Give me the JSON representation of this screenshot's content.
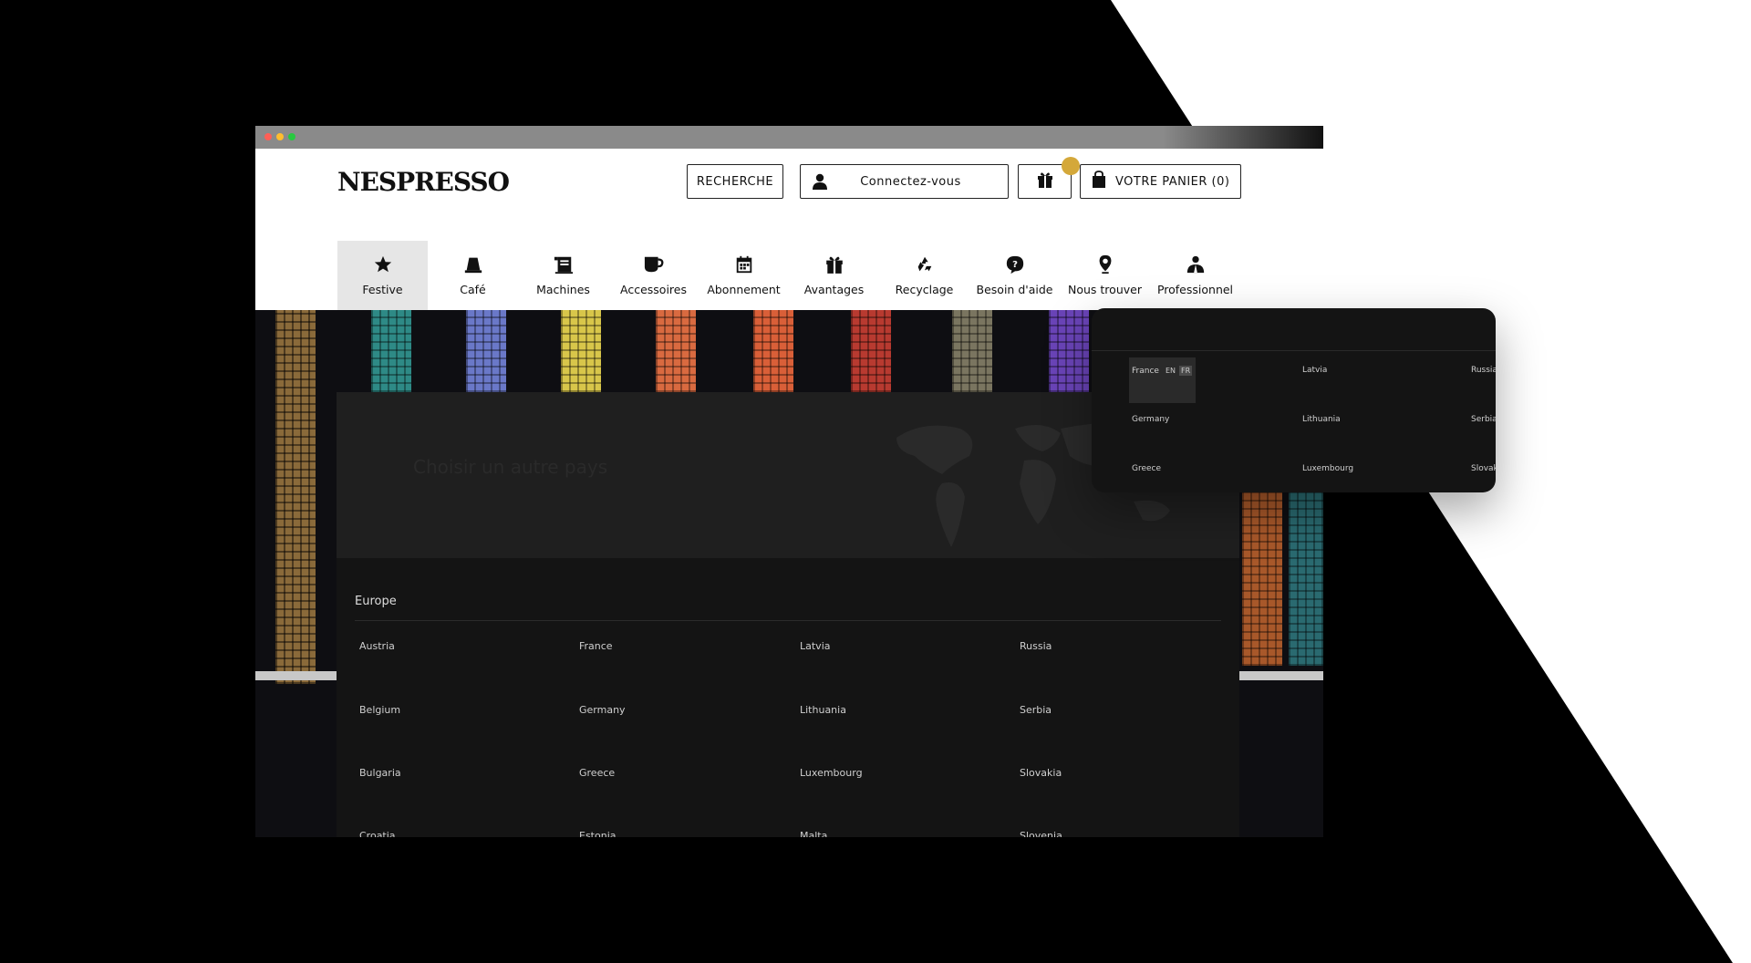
{
  "brand": {
    "logo_text": "NESPRESSO"
  },
  "header": {
    "search_label": "RECHERCHE",
    "login_label": "Connectez-vous",
    "cart_label": "VOTRE PANIER (0)",
    "accent_color": "#d4a83a"
  },
  "nav": {
    "items": [
      {
        "label": "Festive",
        "icon": "star-icon"
      },
      {
        "label": "Café",
        "icon": "coffee-capsule-icon"
      },
      {
        "label": "Machines",
        "icon": "machine-icon"
      },
      {
        "label": "Accessoires",
        "icon": "cup-icon"
      },
      {
        "label": "Abonnement",
        "icon": "calendar-icon"
      },
      {
        "label": "Avantages",
        "icon": "gift-icon"
      },
      {
        "label": "Recyclage",
        "icon": "recycle-icon"
      },
      {
        "label": "Besoin d'aide",
        "icon": "help-icon"
      },
      {
        "label": "Nous trouver",
        "icon": "location-pin-icon"
      },
      {
        "label": "Professionnel",
        "icon": "professional-icon"
      }
    ]
  },
  "country_panel": {
    "title": "Choisir un autre pays",
    "region": "Europe",
    "countries": [
      [
        "Austria",
        "France",
        "Latvia",
        "Russia"
      ],
      [
        "Belgium",
        "Germany",
        "Lithuania",
        "Serbia"
      ],
      [
        "Bulgaria",
        "Greece",
        "Luxembourg",
        "Slovakia"
      ],
      [
        "Croatia",
        "Estonia",
        "Malta",
        "Slovenia"
      ]
    ]
  },
  "popup": {
    "active_country": "France",
    "languages": [
      "EN",
      "FR"
    ],
    "selected_language": "FR",
    "rows": [
      [
        "Latvia",
        "Russia"
      ],
      [
        "Germany",
        "Lithuania",
        "Serbia"
      ],
      [
        "Greece",
        "Luxembourg",
        "Slovaki"
      ]
    ]
  }
}
